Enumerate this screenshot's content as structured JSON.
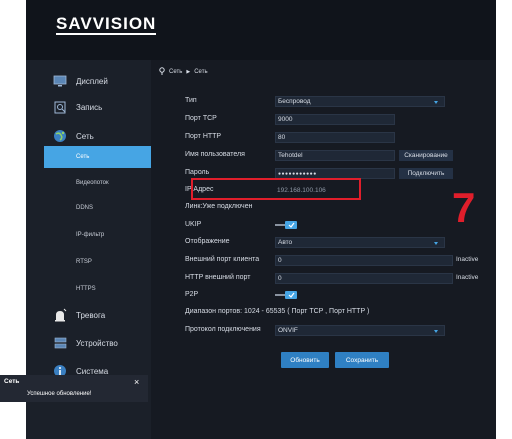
{
  "logo": {
    "text": "SAVVISION"
  },
  "sidebar": {
    "main_items": [
      {
        "label": "Дисплей",
        "icon": "monitor-icon"
      },
      {
        "label": "Запись",
        "icon": "record-search-icon"
      },
      {
        "label": "Сеть",
        "icon": "globe-icon"
      },
      {
        "label": "Тревога",
        "icon": "alarm-icon"
      },
      {
        "label": "Устройство",
        "icon": "device-icon"
      },
      {
        "label": "Система",
        "icon": "info-icon"
      }
    ],
    "sub_items": [
      {
        "label": "Сеть",
        "active": true
      },
      {
        "label": "Видеопоток",
        "active": false
      },
      {
        "label": "DDNS",
        "active": false
      },
      {
        "label": "IP-фильтр",
        "active": false
      },
      {
        "label": "RTSP",
        "active": false
      },
      {
        "label": "HTTPS",
        "active": false
      }
    ]
  },
  "breadcrumb": {
    "root": "Сеть",
    "current": "Сеть"
  },
  "form": {
    "type_label": "Тип",
    "type_value": "Беспровод",
    "tcp_label": "Порт TCP",
    "tcp_value": "9000",
    "http_label": "Порт HTTP",
    "http_value": "80",
    "user_label": "Имя пользователя",
    "user_value": "Tehotdel",
    "scan_button": "Сканирование",
    "password_label": "Пароль",
    "password_value": "●●●●●●●●●●●",
    "connect_button": "Подключить",
    "ip_label": "IP Адрес",
    "ip_value": "192.168.100.106",
    "link_status": "Линк:Уже подключен",
    "ukip_label": "UKIP",
    "ukip_enabled": true,
    "display_label": "Отображение",
    "display_value": "Авто",
    "ext_client_label": "Внешний порт клиента",
    "ext_client_value": "0",
    "ext_client_status": "Inactive",
    "ext_http_label": "HTTP внешний порт",
    "ext_http_value": "0",
    "ext_http_status": "Inactive",
    "p2p_label": "P2P",
    "p2p_enabled": true,
    "port_range_text": "Диапазон портов: 1024 - 65535 ( Порт TCP , Порт HTTP )",
    "protocol_label": "Протокол подключения",
    "protocol_value": "ONVIF",
    "refresh_button": "Обновить",
    "save_button": "Сохранить"
  },
  "annotation": {
    "number": "7",
    "color": "#e01e2b"
  },
  "toast": {
    "title": "Сеть",
    "close": "×",
    "message": "Успешное обновление!"
  },
  "colors": {
    "accent": "#46a5e4",
    "button": "#2f80c3",
    "background": "#161a22",
    "sidebar": "#1b2029"
  }
}
